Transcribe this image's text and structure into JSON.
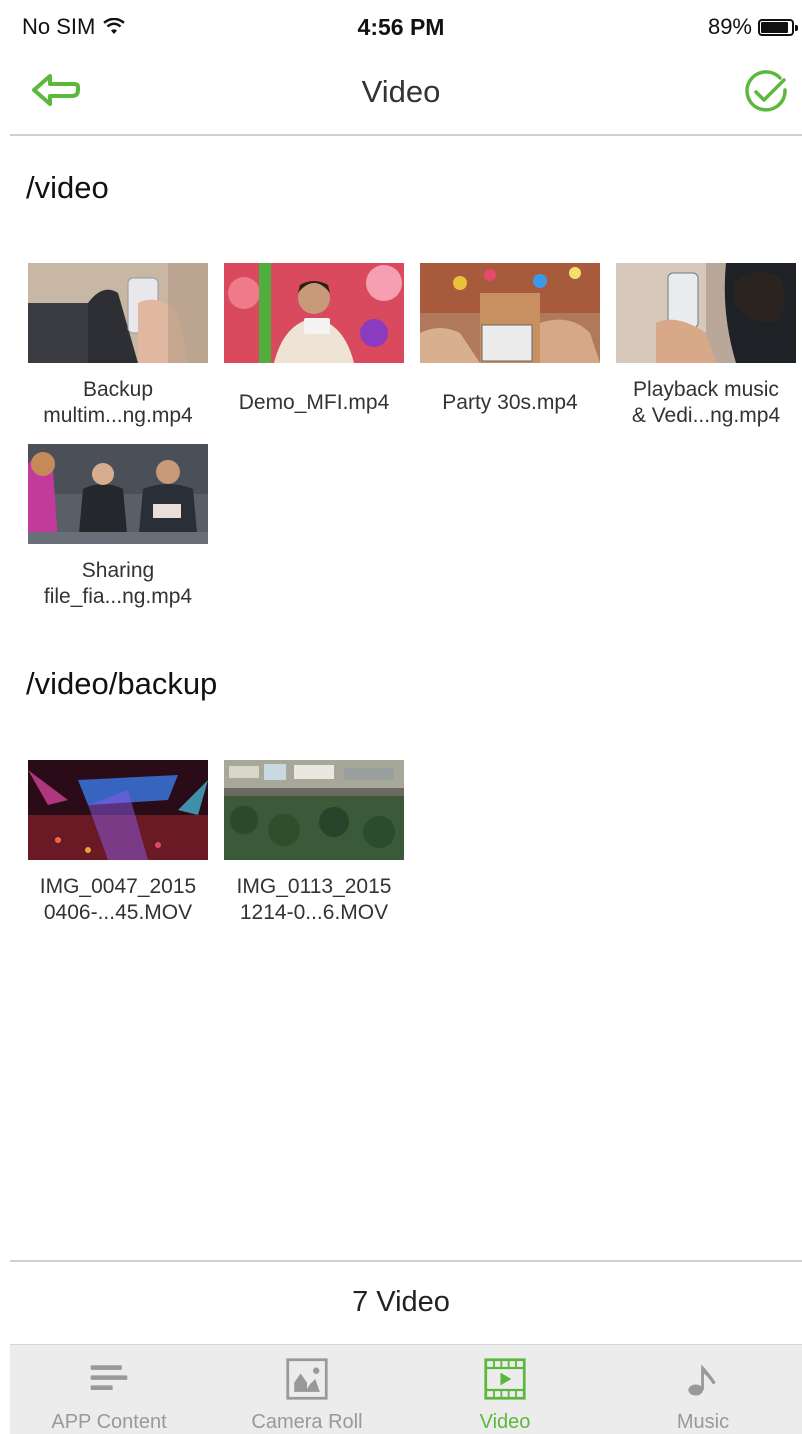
{
  "status_bar": {
    "carrier": "No SIM",
    "time": "4:56 PM",
    "battery": "89%",
    "battery_level": 0.89
  },
  "nav": {
    "title": "Video",
    "back_icon": "back-arrow-icon",
    "done_icon": "check-circle-icon",
    "accent": "#5cb83c"
  },
  "sections": [
    {
      "title": "/video",
      "items": [
        {
          "label": "Backup\nmultim...ng.mp4"
        },
        {
          "label": "Demo_MFI.mp4"
        },
        {
          "label": "Party 30s.mp4"
        },
        {
          "label": "Playback music\n& Vedi...ng.mp4"
        },
        {
          "label": "Sharing\nfile_fia...ng.mp4"
        }
      ]
    },
    {
      "title": "/video/backup",
      "items": [
        {
          "label": "IMG_0047_2015\n0406-...45.MOV"
        },
        {
          "label": "IMG_0113_2015\n1214-0...6.MOV"
        }
      ]
    }
  ],
  "footer": {
    "count": "7 Video"
  },
  "tabs": [
    {
      "label": "APP Content",
      "icon": "list-icon"
    },
    {
      "label": "Camera Roll",
      "icon": "photo-icon"
    },
    {
      "label": "Video",
      "icon": "film-icon",
      "active": true
    },
    {
      "label": "Music",
      "icon": "music-note-icon"
    }
  ]
}
